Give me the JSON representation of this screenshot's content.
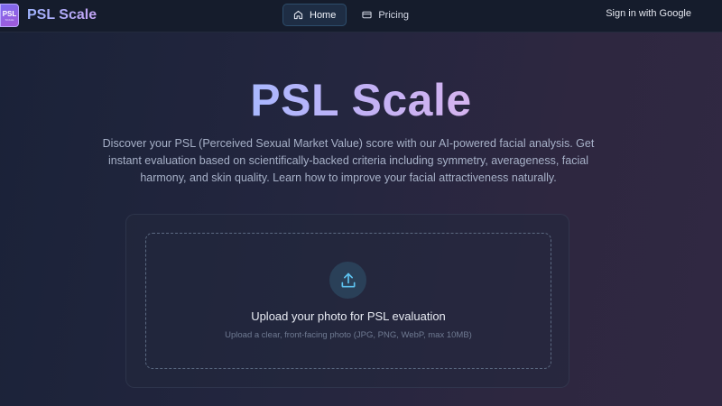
{
  "brand": {
    "logo_text": "PSL",
    "logo_subtext": "SCALE",
    "name": "PSL Scale"
  },
  "nav": {
    "items": [
      {
        "label": "Home",
        "icon": "home-icon",
        "active": true
      },
      {
        "label": "Pricing",
        "icon": "card-icon",
        "active": false
      }
    ],
    "signin_label": "Sign in with Google"
  },
  "hero": {
    "title": "PSL Scale",
    "description": "Discover your PSL (Perceived Sexual Market Value) score with our AI-powered facial analysis. Get instant evaluation based on scientifically-backed criteria including symmetry, averageness, facial harmony, and skin quality. Learn how to improve your facial attractiveness naturally."
  },
  "upload": {
    "icon": "upload-icon",
    "title": "Upload your photo for PSL evaluation",
    "hint": "Upload a clear, front-facing photo (JPG, PNG, WebP, max 10MB)"
  },
  "colors": {
    "accent_blue": "#9fb4ff",
    "accent_purple": "#c4a4f5",
    "topbar_bg": "#151c2c",
    "upload_icon_bg": "#2a4058",
    "upload_arrow": "#5ec3f0"
  }
}
